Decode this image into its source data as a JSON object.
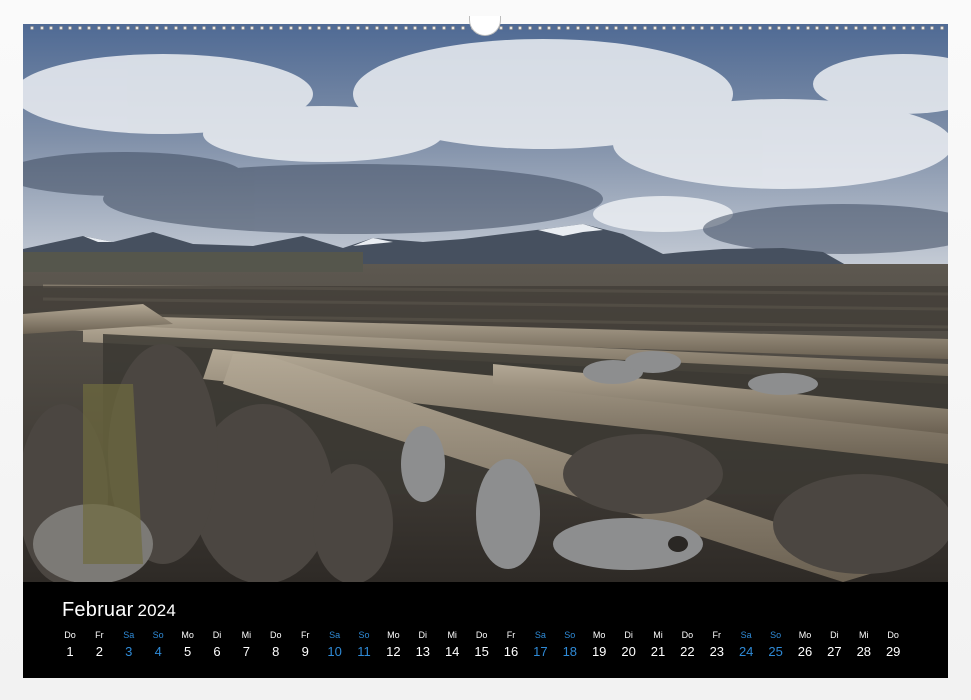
{
  "calendar": {
    "month": "Februar",
    "year": "2024",
    "weekend_color": "#2f8ad6",
    "days": [
      {
        "wd": "Do",
        "num": "1",
        "weekend": false
      },
      {
        "wd": "Fr",
        "num": "2",
        "weekend": false
      },
      {
        "wd": "Sa",
        "num": "3",
        "weekend": true
      },
      {
        "wd": "So",
        "num": "4",
        "weekend": true
      },
      {
        "wd": "Mo",
        "num": "5",
        "weekend": false
      },
      {
        "wd": "Di",
        "num": "6",
        "weekend": false
      },
      {
        "wd": "Mi",
        "num": "7",
        "weekend": false
      },
      {
        "wd": "Do",
        "num": "8",
        "weekend": false
      },
      {
        "wd": "Fr",
        "num": "9",
        "weekend": false
      },
      {
        "wd": "Sa",
        "num": "10",
        "weekend": true
      },
      {
        "wd": "So",
        "num": "11",
        "weekend": true
      },
      {
        "wd": "Mo",
        "num": "12",
        "weekend": false
      },
      {
        "wd": "Di",
        "num": "13",
        "weekend": false
      },
      {
        "wd": "Mi",
        "num": "14",
        "weekend": false
      },
      {
        "wd": "Do",
        "num": "15",
        "weekend": false
      },
      {
        "wd": "Fr",
        "num": "16",
        "weekend": false
      },
      {
        "wd": "Sa",
        "num": "17",
        "weekend": true
      },
      {
        "wd": "So",
        "num": "18",
        "weekend": true
      },
      {
        "wd": "Mo",
        "num": "19",
        "weekend": false
      },
      {
        "wd": "Di",
        "num": "20",
        "weekend": false
      },
      {
        "wd": "Mi",
        "num": "21",
        "weekend": false
      },
      {
        "wd": "Do",
        "num": "22",
        "weekend": false
      },
      {
        "wd": "Fr",
        "num": "23",
        "weekend": false
      },
      {
        "wd": "Sa",
        "num": "24",
        "weekend": true
      },
      {
        "wd": "So",
        "num": "25",
        "weekend": true
      },
      {
        "wd": "Mo",
        "num": "26",
        "weekend": false
      },
      {
        "wd": "Di",
        "num": "27",
        "weekend": false
      },
      {
        "wd": "Mi",
        "num": "28",
        "weekend": false
      },
      {
        "wd": "Do",
        "num": "29",
        "weekend": false
      }
    ]
  },
  "photo": {
    "subject": "stockfish-drying-racks-photo",
    "sky_color": "#5a6d8c",
    "cloud_color": "#e6e9ee",
    "mountain_color": "#4a5568",
    "log_color": "#8a7e6e",
    "fish_color": "#4a4540"
  }
}
